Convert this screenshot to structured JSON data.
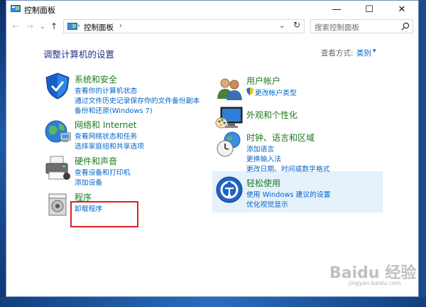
{
  "window": {
    "title": "控制面板"
  },
  "window_buttons": {
    "minimize": "—",
    "maximize": "☐",
    "close": "✕"
  },
  "nav": {
    "back": "←",
    "forward": "→",
    "dropdown": "⌄",
    "up": "↑"
  },
  "address": {
    "path": "控制面板",
    "separator": "›",
    "caret": "⌄",
    "refresh": "↻"
  },
  "search": {
    "placeholder": "搜索控制面板"
  },
  "page": {
    "title": "调整计算机的设置",
    "view_label": "查看方式:",
    "view_value": "类别",
    "view_caret": "▾"
  },
  "categories": [
    {
      "title": "系统和安全",
      "icon": "shield-icon",
      "links": [
        "查看你的计算机状态",
        "通过文件历史记录保存你的文件备份副本",
        "备份和还原(Windows 7)"
      ]
    },
    {
      "title": "网络和 Internet",
      "icon": "network-globe-icon",
      "links": [
        "查看网络状态和任务",
        "选择家庭组和共享选项"
      ]
    },
    {
      "title": "硬件和声音",
      "icon": "printer-icon",
      "links": [
        "查看设备和打印机",
        "添加设备"
      ]
    },
    {
      "title": "程序",
      "icon": "programs-icon",
      "links": [
        "卸载程序"
      ]
    },
    {
      "title": "用户帐户",
      "icon": "users-icon",
      "links": [
        "更改帐户类型"
      ]
    },
    {
      "title": "外观和个性化",
      "icon": "monitor-palette-icon",
      "links": []
    },
    {
      "title": "时钟、语言和区域",
      "icon": "clock-globe-icon",
      "links": [
        "添加语言",
        "更换输入法",
        "更改日期、时间或数字格式"
      ]
    },
    {
      "title": "轻松使用",
      "icon": "ease-of-access-icon",
      "links": [
        "使用 Windows 建议的设置",
        "优化视觉显示"
      ]
    }
  ],
  "watermark": {
    "text": "Baidu 经验",
    "sub": "jingyan.baidu.com"
  },
  "colors": {
    "link": "#0066cc",
    "category_title": "#1f7a1f",
    "page_title": "#1e3287",
    "annotation_box": "#d8232a",
    "selection": "#e5f1fb"
  }
}
